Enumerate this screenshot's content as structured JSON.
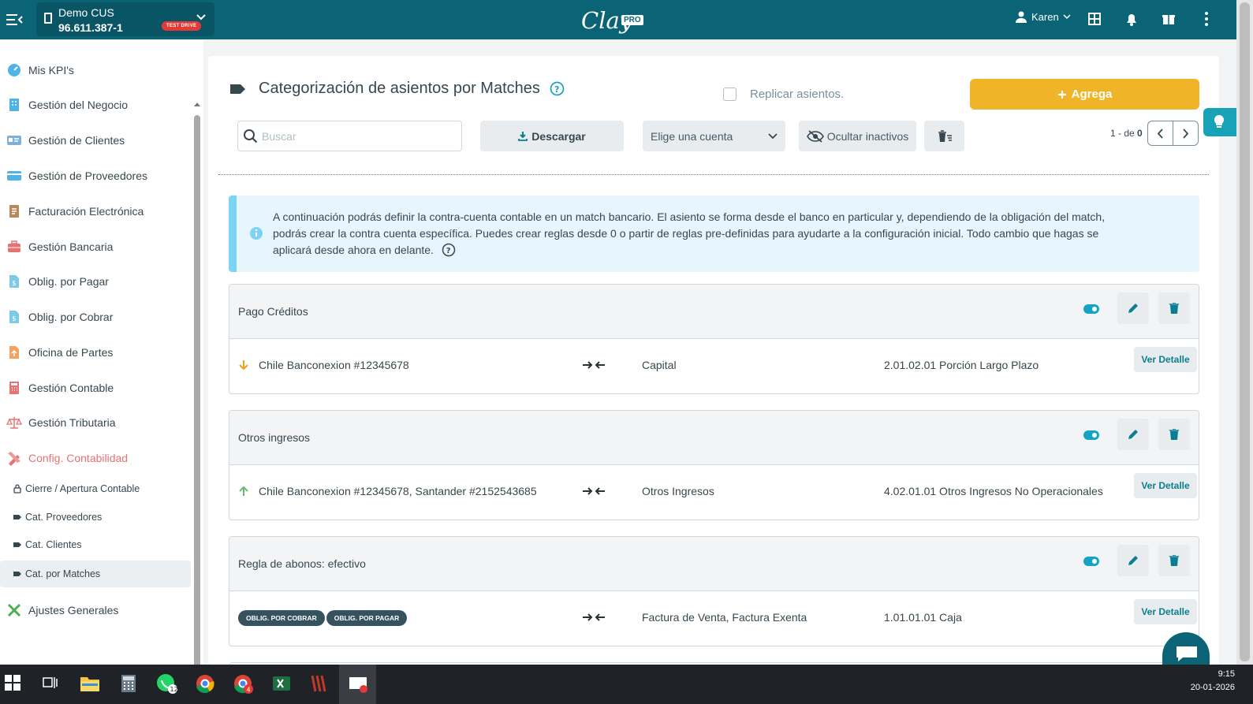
{
  "topbar": {
    "company_name": "Demo CUS",
    "company_rut": "96.611.387-1",
    "company_badge": "TEST DRIVE",
    "logo_text": "Clay",
    "logo_badge": "PRO",
    "user_name": "Karen",
    "brand_color": "#0b6476"
  },
  "sidebar": {
    "items": [
      {
        "label": "Mis KPI's",
        "icon": "gauge-icon"
      },
      {
        "label": "Gestión del Negocio",
        "icon": "building-icon"
      },
      {
        "label": "Gestión de Clientes",
        "icon": "id-card-icon"
      },
      {
        "label": "Gestión de Proveedores",
        "icon": "credit-card-icon"
      },
      {
        "label": "Facturación Electrónica",
        "icon": "invoice-icon"
      },
      {
        "label": "Gestión Bancaria",
        "icon": "briefcase-icon"
      },
      {
        "label": "Oblig. por Pagar",
        "icon": "document-dollar-icon"
      },
      {
        "label": "Oblig. por Cobrar",
        "icon": "document-dollar-icon"
      },
      {
        "label": "Oficina de Partes",
        "icon": "document-upload-icon"
      },
      {
        "label": "Gestión Contable",
        "icon": "calculator-icon"
      },
      {
        "label": "Gestión Tributaria",
        "icon": "scale-icon"
      },
      {
        "label": "Config. Contabilidad",
        "icon": "pencil-ruler-icon"
      }
    ],
    "sub_items": [
      {
        "label": "Cierre / Apertura Contable",
        "icon": "lock-icon"
      },
      {
        "label": "Cat. Proveedores",
        "icon": "tag-icon"
      },
      {
        "label": "Cat. Clientes",
        "icon": "tag-icon"
      },
      {
        "label": "Cat. por Matches",
        "icon": "tag-icon"
      }
    ],
    "last_item": {
      "label": "Ajustes Generales",
      "icon": "tools-icon"
    }
  },
  "main": {
    "title": "Categorización de asientos por Matches",
    "replicar_label": "Replicar asientos.",
    "add_button": "Agrega",
    "search_placeholder": "Buscar",
    "download_button": "Descargar",
    "account_select": "Elige una cuenta",
    "hide_inactive": "Ocultar inactivos",
    "pager_prefix": "1 - de",
    "pager_total": "0",
    "info_text": "A continuación podrás definir la contra-cuenta contable en un match bancario. El asiento se forma desde el banco en particular y, dependiendo de la obligación del match, podrás crear la contra cuenta específica. Puedes crear reglas desde 0 o partir de reglas pre-definidas para ayudarte a la configuración inicial. Todo cambio que hagas se aplicará desde ahora en delante."
  },
  "rules": [
    {
      "name": "Pago Créditos",
      "direction": "down",
      "bank": "Chile Banconexion #12345678",
      "description": "Capital",
      "account": "2.01.02.01 Porción Largo Plazo",
      "detail_button": "Ver Detalle",
      "active": true
    },
    {
      "name": "Otros ingresos",
      "direction": "up",
      "bank": "Chile Banconexion #12345678, Santander #2152543685",
      "description": "Otros Ingresos",
      "account": "4.02.01.01 Otros Ingresos No Operacionales",
      "detail_button": "Ver Detalle",
      "active": true
    },
    {
      "name": "Regla de abonos: efectivo",
      "chips": [
        "OBLIG. POR COBRAR",
        "OBLIG. POR PAGAR"
      ],
      "description": "Factura de Venta, Factura Exenta",
      "account": "1.01.01.01 Caja",
      "detail_button": "Ver Detalle",
      "active": true
    }
  ],
  "taskbar": {
    "time": "9:15",
    "date": "20-01-2026",
    "whatsapp_badge": "12",
    "chrome_badge": "4"
  },
  "colors": {
    "accent": "#f0b429",
    "teal": "#16a2c2",
    "active_nav": "#e57373"
  }
}
